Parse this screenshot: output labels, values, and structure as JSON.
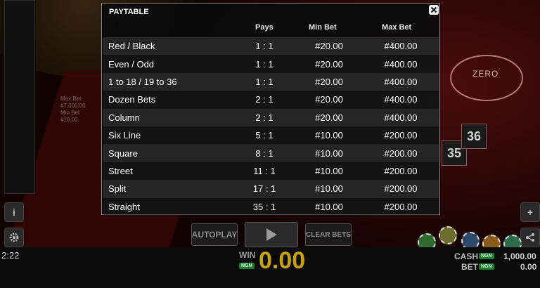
{
  "paytable": {
    "title": "PAYTABLE",
    "columns": {
      "pays": "Pays",
      "min_bet": "Min Bet",
      "max_bet": "Max Bet"
    },
    "rows": [
      {
        "bet": "Red / Black",
        "pays": "1 : 1",
        "min": "#20.00",
        "max": "#400.00"
      },
      {
        "bet": "Even / Odd",
        "pays": "1 : 1",
        "min": "#20.00",
        "max": "#400.00"
      },
      {
        "bet": "1 to 18 / 19 to 36",
        "pays": "1 : 1",
        "min": "#20.00",
        "max": "#400.00"
      },
      {
        "bet": "Dozen Bets",
        "pays": "2 : 1",
        "min": "#20.00",
        "max": "#400.00"
      },
      {
        "bet": "Column",
        "pays": "2 : 1",
        "min": "#20.00",
        "max": "#400.00"
      },
      {
        "bet": "Six Line",
        "pays": "5 : 1",
        "min": "#10.00",
        "max": "#200.00"
      },
      {
        "bet": "Square",
        "pays": "8 : 1",
        "min": "#10.00",
        "max": "#200.00"
      },
      {
        "bet": "Street",
        "pays": "11 : 1",
        "min": "#10.00",
        "max": "#200.00"
      },
      {
        "bet": "Split",
        "pays": "17 : 1",
        "min": "#10.00",
        "max": "#200.00"
      },
      {
        "bet": "Straight",
        "pays": "35 : 1",
        "min": "#10.00",
        "max": "#200.00"
      }
    ]
  },
  "background": {
    "limit_line1": "Max Bet",
    "limit_line2": "#7,000.00",
    "limit_line3": "Min Bet",
    "limit_line4": "#10.00",
    "zero_label": "ZERO",
    "num_35": "35",
    "num_36": "36",
    "time": "2:22"
  },
  "controls": {
    "autoplay_label": "AUTOPLAY",
    "clear_bets_label": "CLEAR BETS",
    "win_label": "WIN",
    "win_value": "0.00",
    "currency_tag": "NGN",
    "cash_label": "CASH",
    "cash_value": "1,000.00",
    "bet_label": "BET",
    "bet_value": "0.00"
  },
  "icons": {
    "info": "info-icon",
    "settings": "gear-icon",
    "plus": "plus-icon",
    "share": "share-icon",
    "play": "play-icon",
    "close": "close-icon"
  },
  "colors": {
    "win_value": "#c8a400",
    "currency_tag_bg": "#1e7f2b",
    "felt": "#3a0707"
  }
}
